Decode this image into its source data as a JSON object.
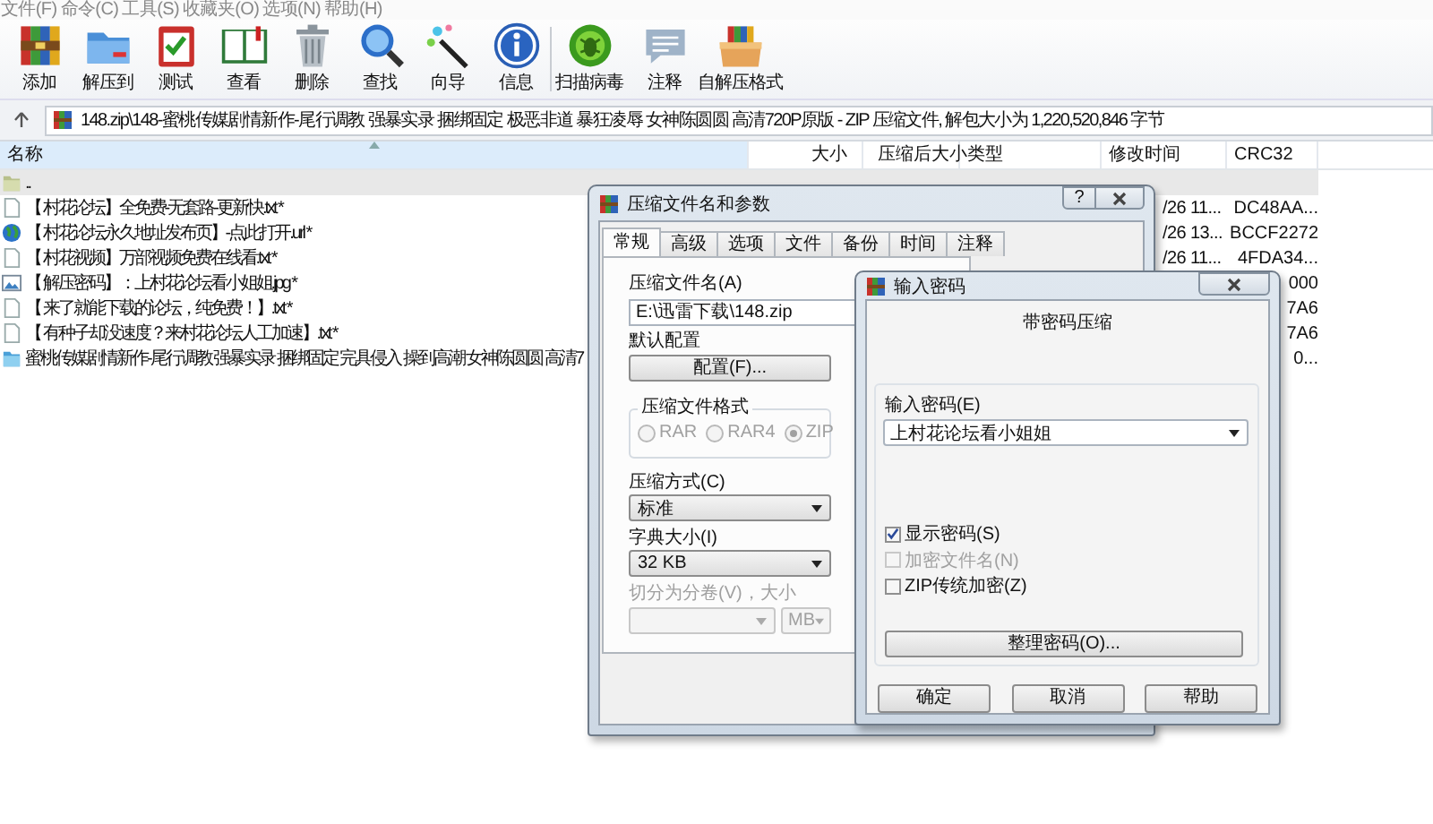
{
  "menu": [
    {
      "label": "文件(F)"
    },
    {
      "label": "命令(C)"
    },
    {
      "label": "工具(S)"
    },
    {
      "label": "收藏夹(O)"
    },
    {
      "label": "选项(N)"
    },
    {
      "label": "帮助(H)"
    }
  ],
  "toolbar": [
    [
      "添加",
      "解压到",
      "测试",
      "查看",
      "删除",
      "查找",
      "向导",
      "信息"
    ],
    [
      "扫描病毒",
      "注释",
      "自解压格式"
    ]
  ],
  "address": {
    "path": "148.zip\\148-蜜桃传媒剧情新作-尾行调教 强暴实录 捆绑固定 极恶非道 暴狂凌辱 女神陈圆圆 高清720P原版 - ZIP 压缩文件, 解包大小为 1,220,520,846 字节"
  },
  "columns": [
    {
      "label": "名称",
      "sorted": true
    },
    {
      "label": "大小",
      "sorted": false
    },
    {
      "label": "压缩后大小",
      "sorted": false
    },
    {
      "label": "类型",
      "sorted": false
    },
    {
      "label": "修改时间",
      "sorted": false
    },
    {
      "label": "CRC32",
      "sorted": false
    }
  ],
  "rows": [
    {
      "kind": "parent",
      "name": "..",
      "selected": true
    },
    {
      "kind": "text",
      "name": "【 村花论坛】全免费-无套路-更新快.txt *",
      "selected": false,
      "modified": "/26 11...",
      "crc": "DC48AA..."
    },
    {
      "kind": "link",
      "name": "【 村花论坛永久地址发布页】-点此打开.url *",
      "selected": false,
      "modified": "/26 13...",
      "crc": "BCCF2272"
    },
    {
      "kind": "text",
      "name": "【 村花视频】万部视频免费在线看.txt *",
      "selected": false,
      "modified": "/26 11...",
      "crc": "4FDA34..."
    },
    {
      "kind": "image",
      "name": "【 解压密码】：上村花论坛看小姐姐.jpg *",
      "selected": false,
      "crc": "000"
    },
    {
      "kind": "text",
      "name": "【 来了就能下载的论坛，纯免费！】.txt *",
      "selected": false,
      "crc": "7A6"
    },
    {
      "kind": "text",
      "name": "【 有种子却没速度？来村花论坛人工加速】.txt *",
      "selected": false,
      "crc": "7A6"
    },
    {
      "kind": "folder",
      "name": "蜜桃传媒剧情新作-尾行调教 强暴实录 捆绑固定 完具侵入 操到高潮 女神陈圆圆 高清7",
      "selected": false,
      "crc": "0..."
    }
  ],
  "archive_dialog": {
    "title": "压缩文件名和参数",
    "help": "?",
    "tabs": [
      {
        "label": "常规",
        "selected": true
      },
      {
        "label": "高级",
        "selected": false
      },
      {
        "label": "选项",
        "selected": false
      },
      {
        "label": "文件",
        "selected": false
      },
      {
        "label": "备份",
        "selected": false
      },
      {
        "label": "时间",
        "selected": false
      },
      {
        "label": "注释",
        "selected": false
      }
    ],
    "archive_name_label": "压缩文件名(A)",
    "archive_name": "E:\\迅雷下载\\148.zip",
    "profile_label": "默认配置",
    "profile_button": "配置(F)...",
    "format_group": {
      "title": "压缩文件格式",
      "disabled": true,
      "options": [
        {
          "label": "RAR",
          "selected": false
        },
        {
          "label": "RAR4",
          "selected": false
        },
        {
          "label": "ZIP",
          "selected": true
        }
      ]
    },
    "method_label": "压缩方式(C)",
    "method": "标准",
    "dict_label": "字典大小(I)",
    "dict": "32 KB",
    "split": {
      "label": "切分为分卷(V)，大小",
      "unit": "MB",
      "disabled": true
    }
  },
  "password_dialog": {
    "title": "输入密码",
    "heading": "带密码压缩",
    "password_label": "输入密码(E)",
    "password": "上村花论坛看小姐姐",
    "options": [
      {
        "label": "显示密码(S)",
        "checked": true,
        "disabled": false
      },
      {
        "label": "加密文件名(N)",
        "checked": false,
        "disabled": true
      },
      {
        "label": "ZIP传统加密(Z)",
        "checked": false,
        "disabled": false
      }
    ],
    "organize_button": "整理密码(O)...",
    "buttons": [
      "确定",
      "取消",
      "帮助"
    ]
  }
}
